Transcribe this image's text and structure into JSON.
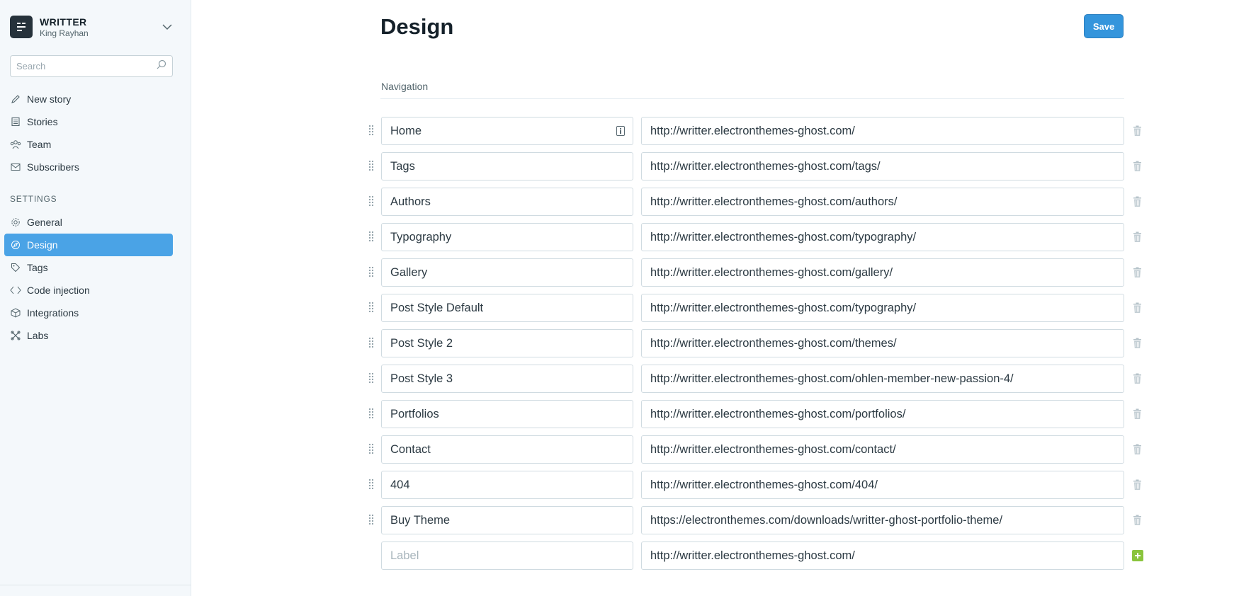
{
  "brand": {
    "title": "WRITTER",
    "user": "King Rayhan"
  },
  "search": {
    "placeholder": "Search"
  },
  "sidebar": {
    "primary": [
      {
        "label": "New story",
        "icon": "pencil-icon"
      },
      {
        "label": "Stories",
        "icon": "document-icon"
      },
      {
        "label": "Team",
        "icon": "team-icon"
      },
      {
        "label": "Subscribers",
        "icon": "mail-icon"
      }
    ],
    "settings_title": "SETTINGS",
    "settings": [
      {
        "label": "General",
        "icon": "gear-icon"
      },
      {
        "label": "Design",
        "icon": "compass-icon",
        "active": true
      },
      {
        "label": "Tags",
        "icon": "tag-icon"
      },
      {
        "label": "Code injection",
        "icon": "code-icon"
      },
      {
        "label": "Integrations",
        "icon": "cube-icon"
      },
      {
        "label": "Labs",
        "icon": "labs-icon"
      }
    ]
  },
  "main": {
    "title": "Design",
    "save_label": "Save",
    "section_label": "Navigation",
    "items": [
      {
        "label": "Home",
        "url": "http://writter.electronthemes-ghost.com/"
      },
      {
        "label": "Tags",
        "url": "http://writter.electronthemes-ghost.com/tags/"
      },
      {
        "label": "Authors",
        "url": "http://writter.electronthemes-ghost.com/authors/"
      },
      {
        "label": "Typography",
        "url": "http://writter.electronthemes-ghost.com/typography/"
      },
      {
        "label": "Gallery",
        "url": "http://writter.electronthemes-ghost.com/gallery/"
      },
      {
        "label": "Post Style Default",
        "url": "http://writter.electronthemes-ghost.com/typography/"
      },
      {
        "label": "Post Style 2",
        "url": "http://writter.electronthemes-ghost.com/themes/"
      },
      {
        "label": "Post Style 3",
        "url": "http://writter.electronthemes-ghost.com/ohlen-member-new-passion-4/"
      },
      {
        "label": "Portfolios",
        "url": "http://writter.electronthemes-ghost.com/portfolios/"
      },
      {
        "label": "Contact",
        "url": "http://writter.electronthemes-ghost.com/contact/"
      },
      {
        "label": "404",
        "url": "http://writter.electronthemes-ghost.com/404/"
      },
      {
        "label": "Buy Theme",
        "url": "https://electronthemes.com/downloads/writter-ghost-portfolio-theme/"
      }
    ],
    "new_item": {
      "label_placeholder": "Label",
      "url": "http://writter.electronthemes-ghost.com/"
    }
  },
  "colors": {
    "accent": "#4aa3e6",
    "save": "#3495dc",
    "add": "#8ac43c",
    "sidebar_bg": "#f4f8fb"
  }
}
